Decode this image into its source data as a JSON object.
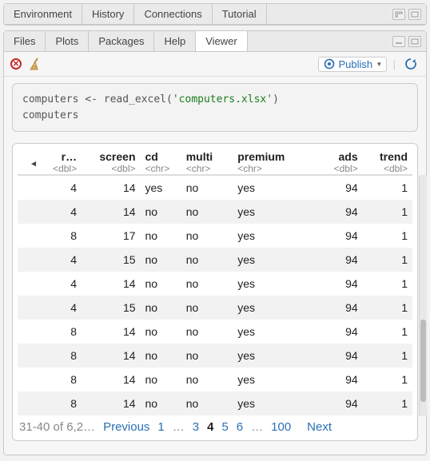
{
  "topPane": {
    "tabs": [
      "Environment",
      "History",
      "Connections",
      "Tutorial"
    ]
  },
  "bottomPane": {
    "tabs": [
      "Files",
      "Plots",
      "Packages",
      "Help",
      "Viewer"
    ],
    "activeTab": "Viewer",
    "publishLabel": "Publish"
  },
  "code": {
    "line1a": "computers <- read_excel(",
    "line1b": "'computers.xlsx'",
    "line1c": ")",
    "line2": "computers"
  },
  "table": {
    "columns": [
      {
        "name": "r…",
        "type": "<dbl>",
        "align": "right"
      },
      {
        "name": "screen",
        "type": "<dbl>",
        "align": "right"
      },
      {
        "name": "cd",
        "type": "<chr>",
        "align": "left"
      },
      {
        "name": "multi",
        "type": "<chr>",
        "align": "left"
      },
      {
        "name": "premium",
        "type": "<chr>",
        "align": "left"
      },
      {
        "name": "ads",
        "type": "<dbl>",
        "align": "right"
      },
      {
        "name": "trend",
        "type": "<dbl>",
        "align": "right"
      }
    ],
    "rows": [
      {
        "r": 4,
        "screen": 14,
        "cd": "yes",
        "multi": "no",
        "premium": "yes",
        "ads": 94,
        "trend": 1
      },
      {
        "r": 4,
        "screen": 14,
        "cd": "no",
        "multi": "no",
        "premium": "yes",
        "ads": 94,
        "trend": 1
      },
      {
        "r": 8,
        "screen": 17,
        "cd": "no",
        "multi": "no",
        "premium": "yes",
        "ads": 94,
        "trend": 1
      },
      {
        "r": 4,
        "screen": 15,
        "cd": "no",
        "multi": "no",
        "premium": "yes",
        "ads": 94,
        "trend": 1
      },
      {
        "r": 4,
        "screen": 14,
        "cd": "no",
        "multi": "no",
        "premium": "yes",
        "ads": 94,
        "trend": 1
      },
      {
        "r": 4,
        "screen": 15,
        "cd": "no",
        "multi": "no",
        "premium": "yes",
        "ads": 94,
        "trend": 1
      },
      {
        "r": 8,
        "screen": 14,
        "cd": "no",
        "multi": "no",
        "premium": "yes",
        "ads": 94,
        "trend": 1
      },
      {
        "r": 8,
        "screen": 14,
        "cd": "no",
        "multi": "no",
        "premium": "yes",
        "ads": 94,
        "trend": 1
      },
      {
        "r": 8,
        "screen": 14,
        "cd": "no",
        "multi": "no",
        "premium": "yes",
        "ads": 94,
        "trend": 1
      },
      {
        "r": 8,
        "screen": 14,
        "cd": "no",
        "multi": "no",
        "premium": "yes",
        "ads": 94,
        "trend": 1
      }
    ]
  },
  "pager": {
    "info": "31-40 of 6,2…",
    "prev": "Previous",
    "next": "Next",
    "pages": [
      "1",
      "…",
      "3",
      "4",
      "5",
      "6",
      "…",
      "100"
    ],
    "current": "4"
  }
}
